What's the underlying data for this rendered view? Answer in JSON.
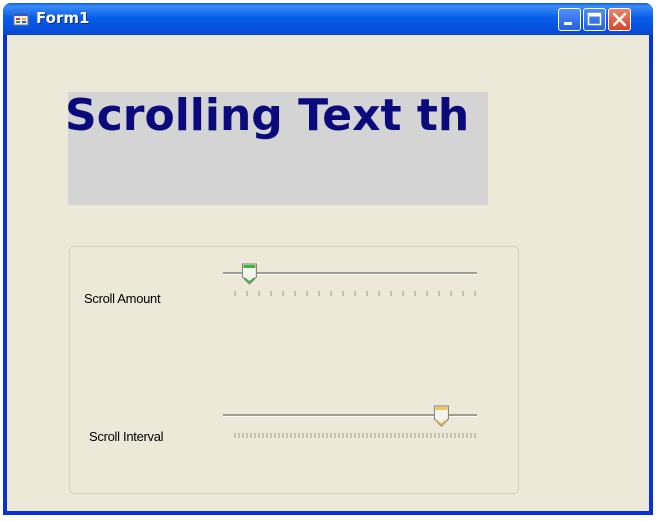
{
  "window": {
    "title": "Form1",
    "icon": "form-app-icon",
    "controls": [
      "minimize-icon",
      "maximize-icon",
      "close-icon"
    ]
  },
  "banner": {
    "text": "Scrolling Text th"
  },
  "group": {
    "scroll_amount": {
      "label": "Scroll Amount",
      "value_fraction": 0.06,
      "tick_count": 21
    },
    "scroll_interval": {
      "label": "Scroll Interval",
      "value_fraction": 0.86,
      "tick_count": 61
    }
  },
  "colors": {
    "titlebar": "#0a5ee9",
    "client": "#ece9d8",
    "banner_bg": "#d4d4d4",
    "banner_text": "#0a0a7d",
    "thumb_green": "#3cb53c",
    "thumb_orange": "#f3c35a"
  }
}
